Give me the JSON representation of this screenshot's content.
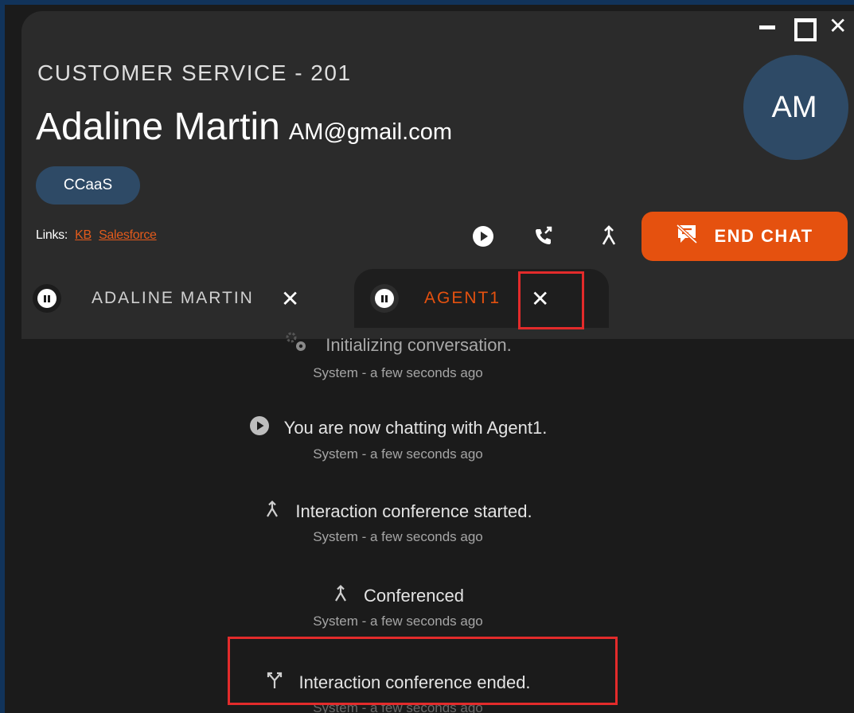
{
  "window": {
    "controls": {
      "minimize": "minimize-icon",
      "maximize": "maximize-icon",
      "close": "✕"
    }
  },
  "header": {
    "queue_title": "CUSTOMER SERVICE - 201",
    "customer_name": "Adaline Martin",
    "customer_email": "AM@gmail.com",
    "avatar_initials": "AM",
    "tag": "CCaaS",
    "links_label": "Links:",
    "links": [
      "KB",
      "Salesforce"
    ],
    "end_chat_label": "END CHAT"
  },
  "tabs": [
    {
      "label": "ADALINE MARTIN",
      "active": false,
      "close": "✕"
    },
    {
      "label": "AGENT1",
      "active": true,
      "close": "✕"
    }
  ],
  "messages": [
    {
      "icon": "gears-icon",
      "text": "Initializing conversation.",
      "meta": "System - a few seconds ago"
    },
    {
      "icon": "play-icon",
      "text": "You are now chatting with Agent1.",
      "meta": "System - a few seconds ago"
    },
    {
      "icon": "merge-icon",
      "text": "Interaction conference started.",
      "meta": "System - a few seconds ago"
    },
    {
      "icon": "merge-icon",
      "text": "Conferenced",
      "meta": "System - a few seconds ago"
    },
    {
      "icon": "split-icon",
      "text": "Interaction conference ended.",
      "meta": "System - a few seconds ago"
    }
  ],
  "colors": {
    "accent": "#e5510f",
    "avatar_bg": "#2e4a66",
    "header_bg": "#2b2b2b",
    "chat_bg": "#1b1b1b",
    "highlight": "#e32b2b"
  }
}
